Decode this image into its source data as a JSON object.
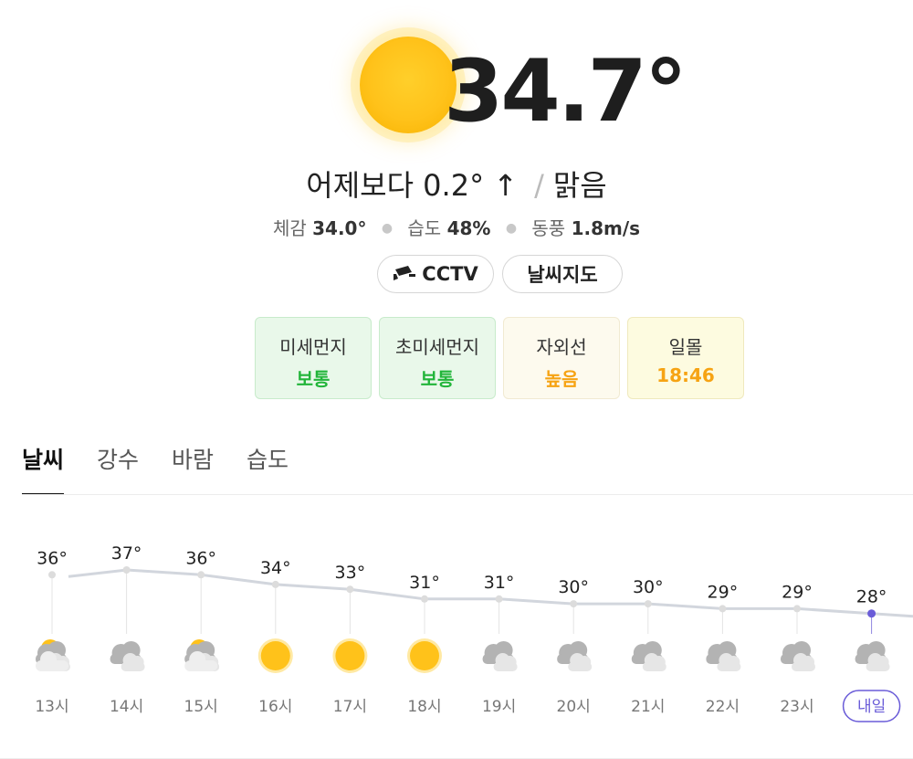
{
  "current": {
    "temperature": "34.7°",
    "compare_text": "어제보다 0.2° ↑",
    "condition": "맑음",
    "feels_label": "체감",
    "feels_value": "34.0°",
    "humidity_label": "습도",
    "humidity_value": "48%",
    "wind_label": "동풍",
    "wind_value": "1.8m/s"
  },
  "buttons": {
    "cctv": "CCTV",
    "weather_map": "날씨지도"
  },
  "air_quality": [
    {
      "label": "미세먼지",
      "value": "보통",
      "color": "#22b53a"
    },
    {
      "label": "초미세먼지",
      "value": "보통",
      "color": "#22b53a"
    },
    {
      "label": "자외선",
      "value": "높음",
      "color": "#f6a313"
    },
    {
      "label": "일몰",
      "value": "18:46",
      "color": "#f6a313"
    }
  ],
  "tabs": [
    "날씨",
    "강수",
    "바람",
    "습도"
  ],
  "active_tab": "날씨",
  "colors": {
    "sun": "#ffc21a",
    "cloud": "#b9b9b9",
    "line": "#d2d6dd",
    "accent": "#6a5cd8"
  },
  "chart_data": {
    "type": "line",
    "x": [
      "13시",
      "14시",
      "15시",
      "16시",
      "17시",
      "18시",
      "19시",
      "20시",
      "21시",
      "22시",
      "23시",
      "내일"
    ],
    "series": [
      {
        "values": [
          36,
          37,
          36,
          34,
          33,
          31,
          31,
          30,
          30,
          29,
          29,
          28
        ]
      }
    ],
    "value_labels": [
      "36°",
      "37°",
      "36°",
      "34°",
      "33°",
      "31°",
      "31°",
      "30°",
      "30°",
      "29°",
      "29°",
      "28°"
    ],
    "icons": [
      "partly-cloudy-icon",
      "cloudy-icon",
      "partly-cloudy-icon",
      "sun-icon",
      "sun-icon",
      "sun-icon",
      "cloudy-icon",
      "cloudy-icon",
      "cloudy-icon",
      "cloudy-icon",
      "cloudy-icon",
      "cloudy-icon"
    ],
    "highlight_index": 11
  }
}
